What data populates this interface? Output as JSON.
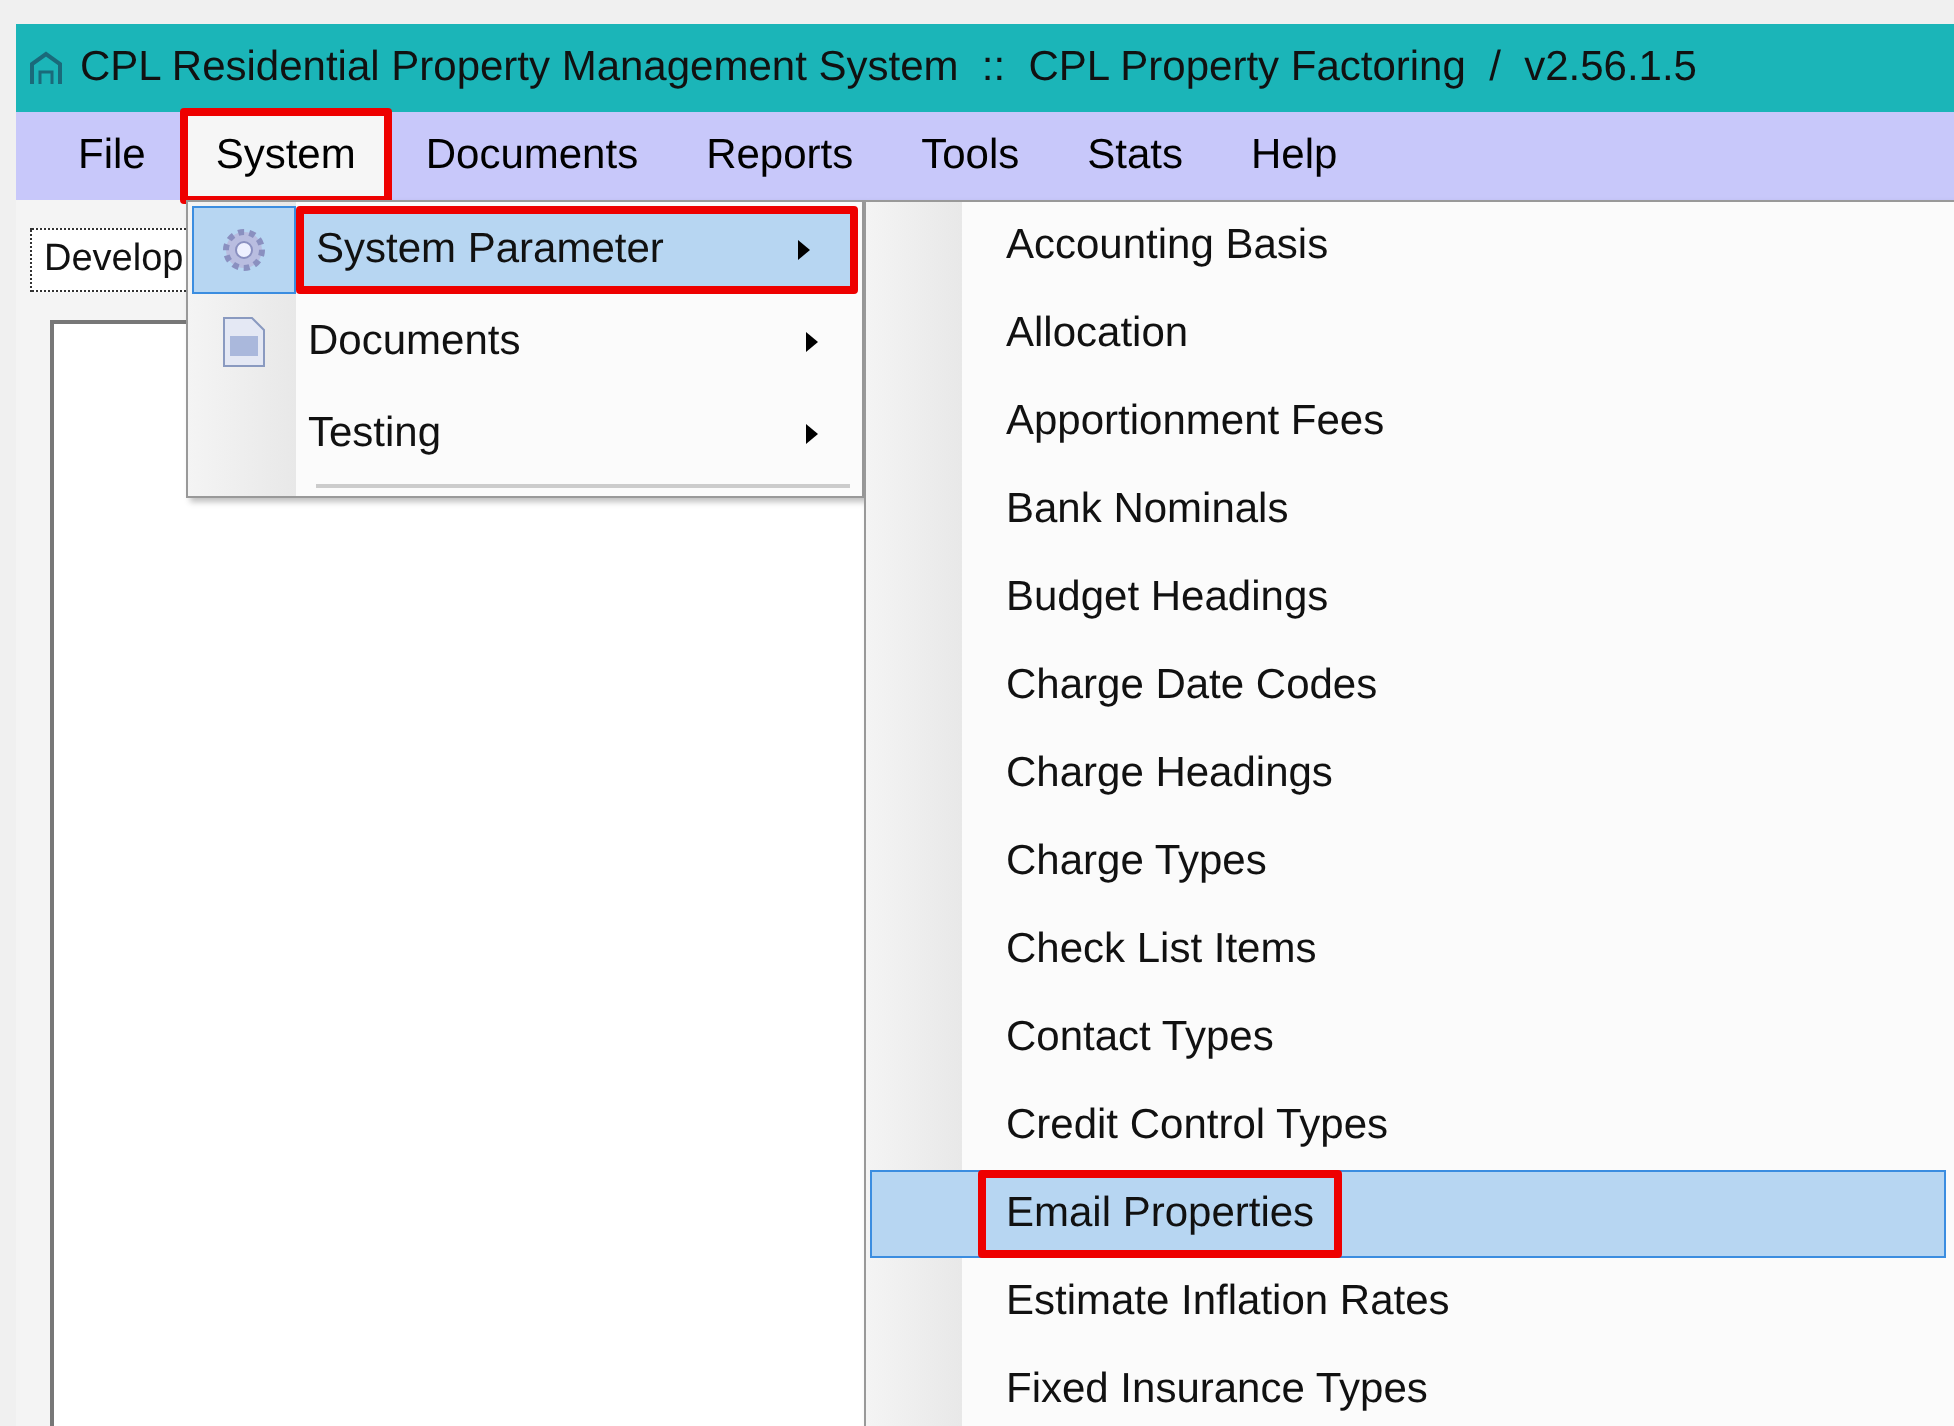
{
  "window": {
    "title": "CPL Residential Property Management System  ::  CPL Property Factoring  /  v2.56.1.5"
  },
  "menu_bar": [
    {
      "label": "File",
      "selected": false,
      "annotated": false
    },
    {
      "label": "System",
      "selected": true,
      "annotated": true
    },
    {
      "label": "Documents",
      "selected": false,
      "annotated": false
    },
    {
      "label": "Reports",
      "selected": false,
      "annotated": false
    },
    {
      "label": "Tools",
      "selected": false,
      "annotated": false
    },
    {
      "label": "Stats",
      "selected": false,
      "annotated": false
    },
    {
      "label": "Help",
      "selected": false,
      "annotated": false
    }
  ],
  "tab": {
    "label": "Develop"
  },
  "system_menu": [
    {
      "label": "System Parameter",
      "kind": "gear",
      "submenu": true,
      "selected": true,
      "annotated": true
    },
    {
      "label": "Documents",
      "kind": "document",
      "submenu": true,
      "selected": false,
      "annotated": false
    },
    {
      "label": "Testing",
      "submenu": true,
      "selected": false,
      "annotated": false
    }
  ],
  "submenu": [
    {
      "label": "Accounting Basis",
      "selected": false,
      "annotated": false
    },
    {
      "label": "Allocation",
      "selected": false,
      "annotated": false
    },
    {
      "label": "Apportionment Fees",
      "selected": false,
      "annotated": false
    },
    {
      "label": "Bank Nominals",
      "selected": false,
      "annotated": false
    },
    {
      "label": "Budget Headings",
      "selected": false,
      "annotated": false
    },
    {
      "label": "Charge Date Codes",
      "selected": false,
      "annotated": false
    },
    {
      "label": "Charge Headings",
      "selected": false,
      "annotated": false
    },
    {
      "label": "Charge Types",
      "selected": false,
      "annotated": false
    },
    {
      "label": "Check List Items",
      "selected": false,
      "annotated": false
    },
    {
      "label": "Contact Types",
      "selected": false,
      "annotated": false
    },
    {
      "label": "Credit Control Types",
      "selected": false,
      "annotated": false
    },
    {
      "label": "Email Properties",
      "selected": true,
      "annotated": true
    },
    {
      "label": "Estimate Inflation Rates",
      "selected": false,
      "annotated": false
    },
    {
      "label": "Fixed Insurance Types",
      "selected": false,
      "annotated": false
    }
  ]
}
